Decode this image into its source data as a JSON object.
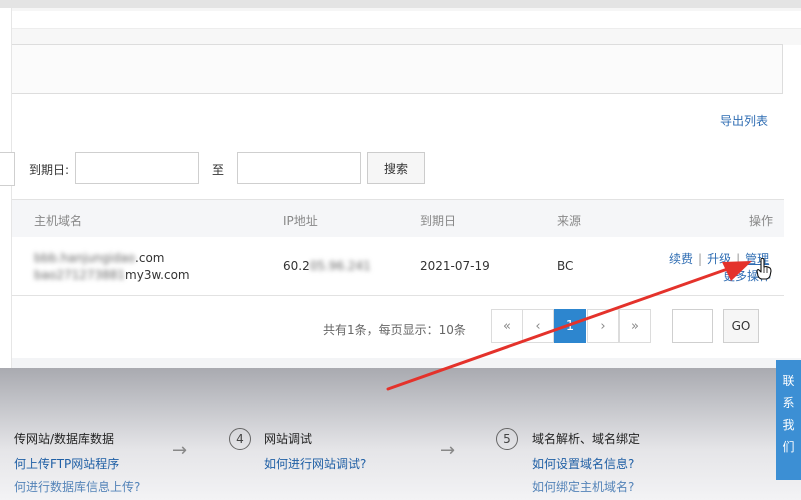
{
  "toolbar": {
    "export_label": "导出列表"
  },
  "filters": {
    "date_label": "到期日:",
    "to_label": "至",
    "start_value": "",
    "end_value": "",
    "search_label": "搜索"
  },
  "table": {
    "headers": [
      "主机域名",
      "IP地址",
      "到期日",
      "来源",
      "操作"
    ],
    "rows": [
      {
        "domain_line1": "bbb.hanjungidao.com",
        "domain_line2": "bao2712738811my3w.com",
        "ip": "60.205.96.241",
        "expiry": "2021-07-19",
        "source": "BC",
        "actions": {
          "renew": "续费",
          "upgrade": "升级",
          "manage": "管理",
          "more": "更多操作"
        }
      }
    ]
  },
  "pagination": {
    "summary": "共有1条，每页显示：10条",
    "first": "«",
    "prev": "‹",
    "current": "1",
    "next": "›",
    "last": "»",
    "goto_value": "",
    "go_label": "GO"
  },
  "steps": [
    {
      "title": "传网站/数据库数据",
      "link1": "何上传FTP网站程序",
      "link2": "何进行数据库信息上传?"
    },
    {
      "number": "4",
      "title": "网站调试",
      "link1": "如何进行网站调试?"
    },
    {
      "number": "5",
      "title": "域名解析、域名绑定",
      "link1": "如何设置域名信息?",
      "link2": "如何绑定主机域名?"
    }
  ],
  "side_float": {
    "text": [
      "联",
      "系",
      "我",
      "们"
    ]
  },
  "icons": {
    "cursor": "pointer-hand-icon",
    "step_arrow": "arrow-right-icon"
  },
  "colors": {
    "link": "#2f6db3",
    "active_page": "#2d86cf",
    "annotation": "#e4322b"
  }
}
